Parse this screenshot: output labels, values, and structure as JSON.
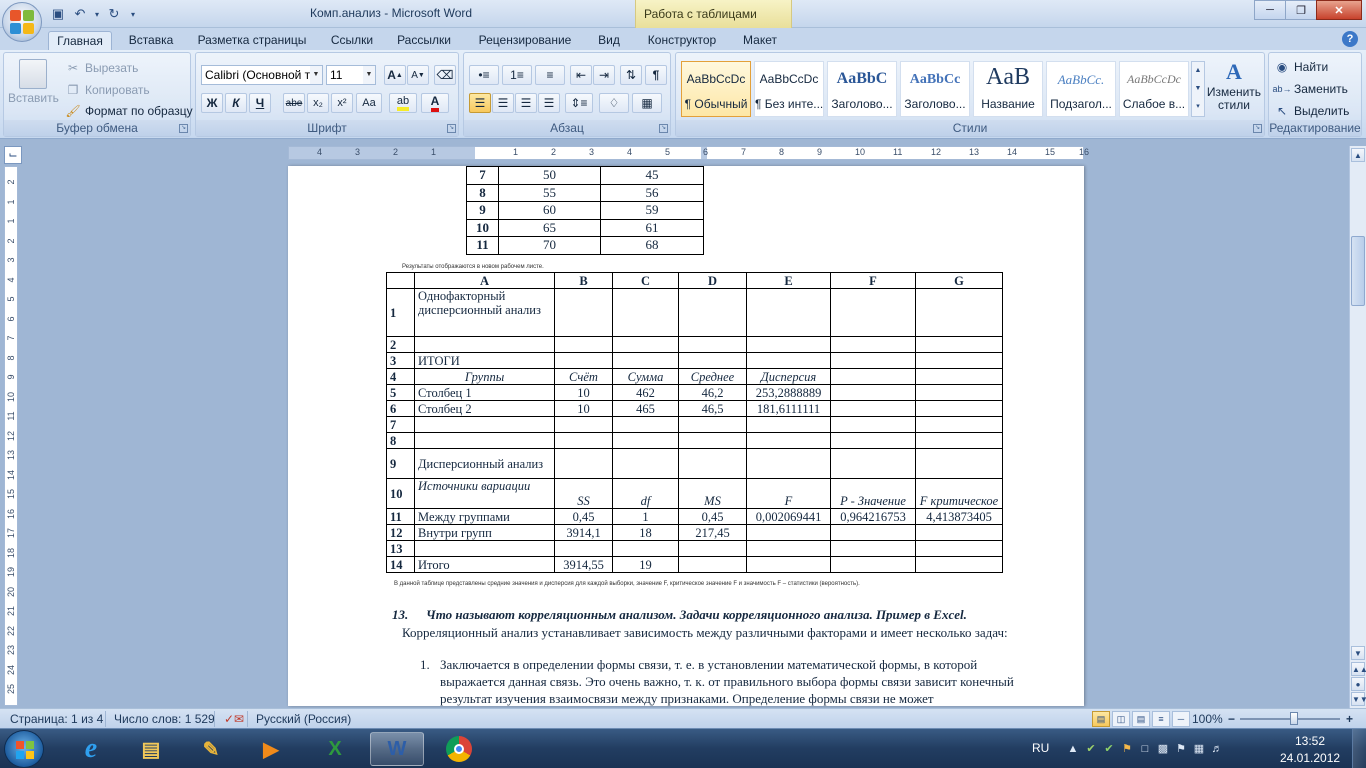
{
  "window": {
    "title": "Комп.анализ - Microsoft Word",
    "context_header": "Работа с таблицами",
    "minimize_icon": "minimize-icon",
    "maximize_icon": "restore-icon",
    "close_icon": "close-icon"
  },
  "tabs": [
    "Главная",
    "Вставка",
    "Разметка страницы",
    "Ссылки",
    "Рассылки",
    "Рецензирование",
    "Вид",
    "Конструктор",
    "Макет"
  ],
  "ribbon": {
    "clipboard": {
      "label": "Буфер обмена",
      "paste": "Вставить",
      "cut": "Вырезать",
      "copy": "Копировать",
      "format_painter": "Формат по образцу"
    },
    "font": {
      "label": "Шрифт",
      "font_name": "Calibri (Основной те",
      "font_size": "11",
      "bold": "Ж",
      "italic": "К",
      "underline": "Ч",
      "strike": "abe",
      "subscript": "x₂",
      "superscript": "x²",
      "change_case": "Aa",
      "grow": "A",
      "shrink": "A"
    },
    "paragraph": {
      "label": "Абзац",
      "pilcrow": "¶"
    },
    "styles": {
      "label": "Стили",
      "items": [
        {
          "sample": "AaBbCcDc",
          "name": "¶ Обычный"
        },
        {
          "sample": "AaBbCcDc",
          "name": "¶ Без инте..."
        },
        {
          "sample": "AaBbC",
          "name": "Заголово..."
        },
        {
          "sample": "AaBbCc",
          "name": "Заголово..."
        },
        {
          "sample": "AaB",
          "name": "Название"
        },
        {
          "sample": "AaBbCc.",
          "name": "Подзагол..."
        },
        {
          "sample": "AaBbCcDc",
          "name": "Слабое в..."
        }
      ],
      "change_styles": "Изменить стили"
    },
    "editing": {
      "label": "Редактирование",
      "find": "Найти",
      "replace": "Заменить",
      "select": "Выделить"
    }
  },
  "ruler": {
    "h_numbers": [
      "4",
      "3",
      "2",
      "1",
      "1",
      "2",
      "3",
      "4",
      "5",
      "6",
      "7",
      "8",
      "9",
      "10",
      "11",
      "12",
      "13",
      "14",
      "15",
      "16"
    ],
    "v_numbers": [
      "2",
      "1",
      "1",
      "2",
      "3",
      "4",
      "5",
      "6",
      "7",
      "8",
      "9",
      "10",
      "11",
      "12",
      "13",
      "14",
      "15",
      "16",
      "17",
      "18",
      "19",
      "20",
      "21",
      "22",
      "23",
      "24",
      "25"
    ],
    "tab_stop_icon": "tab-stop-icon"
  },
  "document": {
    "table1_rows": [
      [
        "7",
        "50",
        "45"
      ],
      [
        "8",
        "55",
        "56"
      ],
      [
        "9",
        "60",
        "59"
      ],
      [
        "10",
        "65",
        "61"
      ],
      [
        "11",
        "70",
        "68"
      ]
    ],
    "caption_small": "Результаты отображаются в новом рабочем листе.",
    "table2": {
      "headers": [
        "",
        "A",
        "B",
        "C",
        "D",
        "E",
        "F",
        "G"
      ],
      "rows": [
        [
          "1",
          "Однофакторный дисперсионный анализ",
          "",
          "",
          "",
          "",
          "",
          ""
        ],
        [
          "2",
          "",
          "",
          "",
          "",
          "",
          "",
          ""
        ],
        [
          "3",
          "ИТОГИ",
          "",
          "",
          "",
          "",
          "",
          ""
        ],
        [
          "4",
          "Группы",
          "Счёт",
          "Сумма",
          "Среднее",
          "Дисперсия",
          "",
          ""
        ],
        [
          "5",
          "Столбец 1",
          "10",
          "462",
          "46,2",
          "253,2888889",
          "",
          ""
        ],
        [
          "6",
          "Столбец 2",
          "10",
          "465",
          "46,5",
          "181,6111111",
          "",
          ""
        ],
        [
          "7",
          "",
          "",
          "",
          "",
          "",
          "",
          ""
        ],
        [
          "8",
          "",
          "",
          "",
          "",
          "",
          "",
          ""
        ],
        [
          "9",
          "Дисперсионный анализ",
          "",
          "",
          "",
          "",
          "",
          ""
        ],
        [
          "10",
          "Источники вариации",
          "SS",
          "df",
          "MS",
          "F",
          "P - Значение",
          "F критическое"
        ],
        [
          "11",
          "Между группами",
          "0,45",
          "1",
          "0,45",
          "0,002069441",
          "0,964216753",
          "4,413873405"
        ],
        [
          "12",
          "Внутри групп",
          "3914,1",
          "18",
          "217,45",
          "",
          "",
          ""
        ],
        [
          "13",
          "",
          "",
          "",
          "",
          "",
          "",
          ""
        ],
        [
          "14",
          "Итого",
          "3914,55",
          "19",
          "",
          "",
          "",
          ""
        ]
      ]
    },
    "caption_small2": "В данной таблице представлены средние значения и дисперсия для каждой выборки, значение F, критическое значение F и значимость F – статистики (вероятность).",
    "heading13_num": "13.",
    "heading13_text": "Что называют корреляционным анализом. Задачи корреляционного анализа. Пример в Excel.",
    "para1": "Корреляционный анализ устанавливает зависимость между различными факторами и имеет несколько задач:",
    "list1_marker": "1.",
    "list1_text": "Заключается в определении формы связи, т. е. в установлении математической формы, в которой выражается данная связь. Это очень важно, т. к. от правильного выбора формы связи зависит конечный результат изучения взаимосвязи  между признаками. Определение формы связи не может"
  },
  "statusbar": {
    "page": "Страница: 1 из 4",
    "words": "Число слов: 1 529",
    "language": "Русский (Россия)",
    "zoom": "100%",
    "zoom_minus": "−",
    "zoom_plus": "+"
  },
  "taskbar": {
    "lang": "RU",
    "time": "13:52",
    "date": "24.01.2012"
  }
}
